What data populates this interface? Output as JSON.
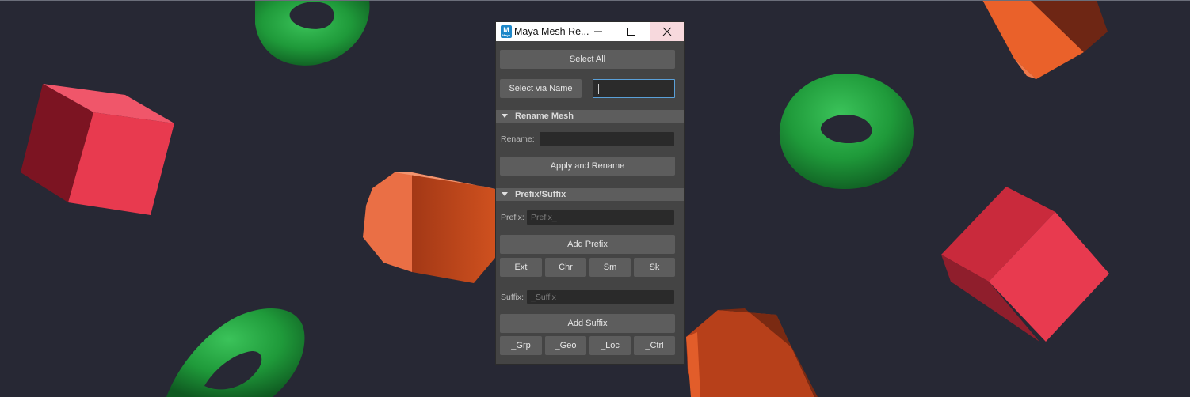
{
  "window": {
    "title": "Maya Mesh Re...",
    "icon_text": "M",
    "icon_subtext": "Maya"
  },
  "select": {
    "select_all_label": "Select All",
    "select_via_name_label": "Select via Name",
    "name_field_value": ""
  },
  "rename_section": {
    "header": "Rename Mesh",
    "rename_label": "Rename:",
    "rename_value": "",
    "apply_label": "Apply and Rename"
  },
  "prefix_suffix_section": {
    "header": "Prefix/Suffix",
    "prefix_label": "Prefix:",
    "prefix_placeholder": "Prefix_",
    "add_prefix_label": "Add Prefix",
    "prefix_presets": [
      "Ext",
      "Chr",
      "Sm",
      "Sk"
    ],
    "suffix_label": "Suffix:",
    "suffix_placeholder": "_Suffix",
    "add_suffix_label": "Add Suffix",
    "suffix_presets": [
      "_Grp",
      "_Geo",
      "_Loc",
      "_Ctrl"
    ]
  },
  "icons": {
    "minimize": "minimize-icon",
    "maximize": "maximize-icon",
    "close": "close-icon",
    "collapse": "triangle-down-icon"
  },
  "colors": {
    "background": "#272834",
    "torus": "#1f9a3a",
    "cube": "#e83a4f",
    "prism": "#e25d2a",
    "panel": "#444444",
    "button": "#5d5d5d"
  }
}
